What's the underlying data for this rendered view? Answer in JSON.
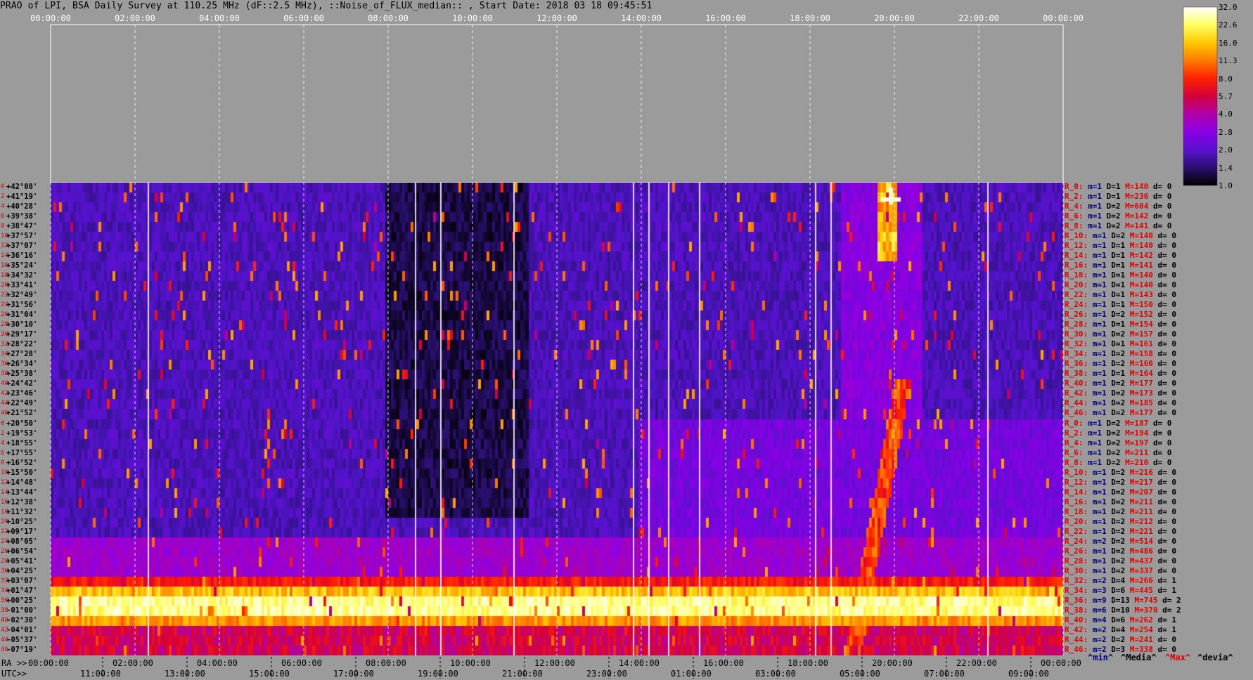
{
  "title": "PRAO of LPI, BSA Daily Survey at 110.25 MHz (dF::2.5 MHz), ::Noise_of_FLUX_median:: , Start Date: 2018 03 18 09:45:51",
  "top_ticks": [
    "00:00:00",
    "02:00:00",
    "04:00:00",
    "06:00:00",
    "08:00:00",
    "10:00:00",
    "12:00:00",
    "14:00:00",
    "16:00:00",
    "18:00:00",
    "20:00:00",
    "22:00:00",
    "00:00:00"
  ],
  "bottom_ra_prefix": "RA >>",
  "bottom_ra_ticks": [
    "00:00:00",
    "02:00:00",
    "04:00:00",
    "06:00:00",
    "08:00:00",
    "10:00:00",
    "12:00:00",
    "14:00:00",
    "16:00:00",
    "18:00:00",
    "20:00:00",
    "22:00:00",
    "00:00:00"
  ],
  "bottom_utc_prefix": "UTC>>",
  "bottom_utc_ticks": [
    "11:00:00",
    "13:00:00",
    "15:00:00",
    "17:00:00",
    "19:00:00",
    "21:00:00",
    "23:00:00",
    "01:00:00",
    "03:00:00",
    "05:00:00",
    "07:00:00",
    "09:00:00"
  ],
  "colorbar": {
    "ticks": [
      "32.0",
      "22.6",
      "16.0",
      "11.3",
      "8.0",
      "5.7",
      "4.0",
      "2.8",
      "2.0",
      "1.4",
      "1.0"
    ],
    "colors": [
      "#ffffff",
      "#ffff60",
      "#ffc800",
      "#ff7a00",
      "#ff2000",
      "#d4003c",
      "#b000a8",
      "#8a00e6",
      "#5a10d0",
      "#2a1070",
      "#000000"
    ]
  },
  "legend": {
    "min": "^min^",
    "median": "^Media^",
    "max": "^Max^",
    "devia": "^devia^"
  },
  "chart_data": {
    "type": "heatmap",
    "title": "PRAO of LPI, BSA Daily Survey at 110.25 MHz (dF::2.5 MHz), ::Noise_of_FLUX_median:: , Start Date: 2018 03 18 09:45:51",
    "x_axis": "RA 00:00:00 to 24:00:00 (UTC 09:45:51 start)",
    "colorbar_range": [
      1.0,
      32.0
    ],
    "colorbar_scale": "log",
    "declinations": [
      "+42°08'",
      "+41°19'",
      "+40°28'",
      "+39°38'",
      "+38°47'",
      "+37°57'",
      "+37°07'",
      "+36°16'",
      "+35°24'",
      "+34°32'",
      "+33°41'",
      "+32°49'",
      "+31°56'",
      "+31°04'",
      "+30°10'",
      "+29°17'",
      "+28°22'",
      "+27°28'",
      "+26°34'",
      "+25°38'",
      "+24°42'",
      "+23°46'",
      "+22°49'",
      "+21°52'",
      "+20°50'",
      "+19°53'",
      "+18°55'",
      "+17°55'",
      "+16°52'",
      "+15°50'",
      "+14°48'",
      "+13°44'",
      "+12°38'",
      "+11°32'",
      "+10°25'",
      "+09°17'",
      "+08°05'",
      "+06°54'",
      "+05°41'",
      "+04°25'",
      "+03°07'",
      "+01°47'",
      "+00°25'",
      "-01°00'",
      "-02°30'",
      "-04°01'",
      "-05°37'",
      "-07°19'"
    ],
    "row_index_labels": [
      "0",
      "2",
      "4",
      "6",
      "8",
      "10",
      "12",
      "14",
      "16",
      "18",
      "20",
      "22",
      "24",
      "26",
      "28",
      "30",
      "32",
      "34",
      "36",
      "38",
      "40",
      "42",
      "44",
      "46",
      "0",
      "2",
      "4",
      "6",
      "8",
      "10",
      "12",
      "14",
      "16",
      "18",
      "20",
      "22",
      "24",
      "26",
      "28",
      "30",
      "32",
      "34",
      "36",
      "38",
      "40",
      "42",
      "44",
      "46"
    ],
    "row_stats": [
      {
        "r": "R_0:",
        "m": "m=1",
        "D": "D=1",
        "M": "M=140",
        "d": "d= 0"
      },
      {
        "r": "R_2:",
        "m": "m=1",
        "D": "D=1",
        "M": "M=236",
        "d": "d= 0"
      },
      {
        "r": "R_4:",
        "m": "m=1",
        "D": "D=2",
        "M": "M=604",
        "d": "d= 0"
      },
      {
        "r": "R_6:",
        "m": "m=1",
        "D": "D=2",
        "M": "M=142",
        "d": "d= 0"
      },
      {
        "r": "R_8:",
        "m": "m=1",
        "D": "D=2",
        "M": "M=141",
        "d": "d= 0"
      },
      {
        "r": "R_10:",
        "m": "m=1",
        "D": "D=2",
        "M": "M=140",
        "d": "d= 0"
      },
      {
        "r": "R_12:",
        "m": "m=1",
        "D": "D=1",
        "M": "M=140",
        "d": "d= 0"
      },
      {
        "r": "R_14:",
        "m": "m=1",
        "D": "D=1",
        "M": "M=142",
        "d": "d= 0"
      },
      {
        "r": "R_16:",
        "m": "m=1",
        "D": "D=1",
        "M": "M=141",
        "d": "d= 0"
      },
      {
        "r": "R_18:",
        "m": "m=1",
        "D": "D=1",
        "M": "M=140",
        "d": "d= 0"
      },
      {
        "r": "R_20:",
        "m": "m=1",
        "D": "D=1",
        "M": "M=140",
        "d": "d= 0"
      },
      {
        "r": "R_22:",
        "m": "m=1",
        "D": "D=1",
        "M": "M=143",
        "d": "d= 0"
      },
      {
        "r": "R_24:",
        "m": "m=1",
        "D": "D=1",
        "M": "M=150",
        "d": "d= 0"
      },
      {
        "r": "R_26:",
        "m": "m=1",
        "D": "D=2",
        "M": "M=152",
        "d": "d= 0"
      },
      {
        "r": "R_28:",
        "m": "m=1",
        "D": "D=1",
        "M": "M=154",
        "d": "d= 0"
      },
      {
        "r": "R_30:",
        "m": "m=1",
        "D": "D=2",
        "M": "M=157",
        "d": "d= 0"
      },
      {
        "r": "R_32:",
        "m": "m=1",
        "D": "D=1",
        "M": "M=161",
        "d": "d= 0"
      },
      {
        "r": "R_34:",
        "m": "m=1",
        "D": "D=2",
        "M": "M=158",
        "d": "d= 0"
      },
      {
        "r": "R_36:",
        "m": "m=1",
        "D": "D=2",
        "M": "M=160",
        "d": "d= 0"
      },
      {
        "r": "R_38:",
        "m": "m=1",
        "D": "D=1",
        "M": "M=164",
        "d": "d= 0"
      },
      {
        "r": "R_40:",
        "m": "m=1",
        "D": "D=2",
        "M": "M=177",
        "d": "d= 0"
      },
      {
        "r": "R_42:",
        "m": "m=1",
        "D": "D=2",
        "M": "M=173",
        "d": "d= 0"
      },
      {
        "r": "R_44:",
        "m": "m=1",
        "D": "D=2",
        "M": "M=185",
        "d": "d= 0"
      },
      {
        "r": "R_46:",
        "m": "m=1",
        "D": "D=2",
        "M": "M=177",
        "d": "d= 0"
      },
      {
        "r": "R_0:",
        "m": "m=1",
        "D": "D=2",
        "M": "M=187",
        "d": "d= 0"
      },
      {
        "r": "R_2:",
        "m": "m=1",
        "D": "D=2",
        "M": "M=194",
        "d": "d= 0"
      },
      {
        "r": "R_4:",
        "m": "m=1",
        "D": "D=2",
        "M": "M=197",
        "d": "d= 0"
      },
      {
        "r": "R_6:",
        "m": "m=1",
        "D": "D=2",
        "M": "M=211",
        "d": "d= 0"
      },
      {
        "r": "R_8:",
        "m": "m=1",
        "D": "D=2",
        "M": "M=210",
        "d": "d= 0"
      },
      {
        "r": "R_10:",
        "m": "m=1",
        "D": "D=2",
        "M": "M=216",
        "d": "d= 0"
      },
      {
        "r": "R_12:",
        "m": "m=1",
        "D": "D=2",
        "M": "M=217",
        "d": "d= 0"
      },
      {
        "r": "R_14:",
        "m": "m=1",
        "D": "D=2",
        "M": "M=207",
        "d": "d= 0"
      },
      {
        "r": "R_16:",
        "m": "m=1",
        "D": "D=2",
        "M": "M=211",
        "d": "d= 0"
      },
      {
        "r": "R_18:",
        "m": "m=1",
        "D": "D=2",
        "M": "M=211",
        "d": "d= 0"
      },
      {
        "r": "R_20:",
        "m": "m=1",
        "D": "D=2",
        "M": "M=212",
        "d": "d= 0"
      },
      {
        "r": "R_22:",
        "m": "m=1",
        "D": "D=2",
        "M": "M=221",
        "d": "d= 0"
      },
      {
        "r": "R_24:",
        "m": "m=2",
        "D": "D=2",
        "M": "M=514",
        "d": "d= 0"
      },
      {
        "r": "R_26:",
        "m": "m=1",
        "D": "D=2",
        "M": "M=486",
        "d": "d= 0"
      },
      {
        "r": "R_28:",
        "m": "m=1",
        "D": "D=2",
        "M": "M=437",
        "d": "d= 0"
      },
      {
        "r": "R_30:",
        "m": "m=1",
        "D": "D=2",
        "M": "M=337",
        "d": "d= 0"
      },
      {
        "r": "R_32:",
        "m": "m=2",
        "D": "D=4",
        "M": "M=266",
        "d": "d= 1"
      },
      {
        "r": "R_34:",
        "m": "m=3",
        "D": "D=6",
        "M": "M=445",
        "d": "d= 1"
      },
      {
        "r": "R_36:",
        "m": "m=9",
        "D": "D=13",
        "M": "M=745",
        "d": "d= 2"
      },
      {
        "r": "R_38:",
        "m": "m=6",
        "D": "D=10",
        "M": "M=370",
        "d": "d= 2"
      },
      {
        "r": "R_40:",
        "m": "m=4",
        "D": "D=6",
        "M": "M=262",
        "d": "d= 1"
      },
      {
        "r": "R_42:",
        "m": "m=2",
        "D": "D=4",
        "M": "M=254",
        "d": "d= 1"
      },
      {
        "r": "R_44:",
        "m": "m=2",
        "D": "D=2",
        "M": "M=241",
        "d": "d= 0"
      },
      {
        "r": "R_46:",
        "m": "m=2",
        "D": "D=3",
        "M": "M=338",
        "d": "d= 0"
      }
    ]
  }
}
